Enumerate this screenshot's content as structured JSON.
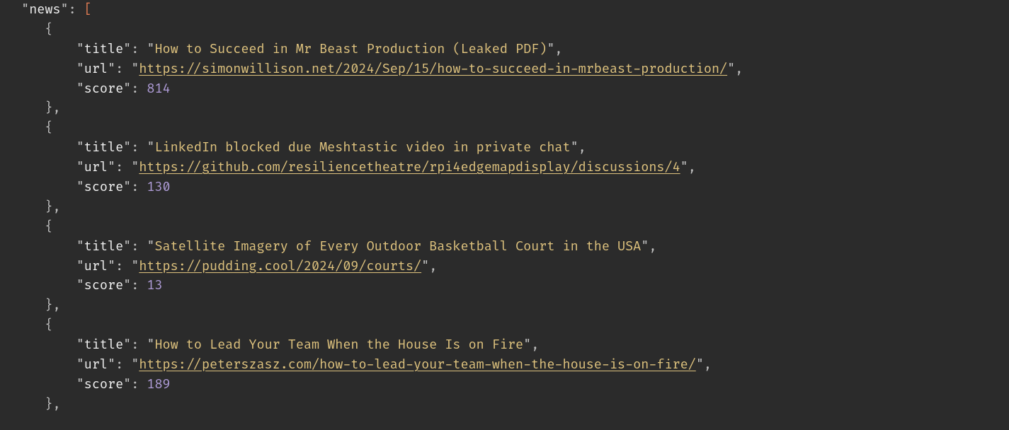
{
  "root_key": "news",
  "items": [
    {
      "title": "How to Succeed in Mr Beast Production (Leaked PDF)",
      "url": "https://simonwillison.net/2024/Sep/15/how-to-succeed-in-mrbeast-production/",
      "score": 814
    },
    {
      "title": "LinkedIn blocked due Meshtastic video in private chat",
      "url": "https://github.com/resiliencetheatre/rpi4edgemapdisplay/discussions/4",
      "score": 130
    },
    {
      "title": "Satellite Imagery of Every Outdoor Basketball Court in the USA",
      "url": "https://pudding.cool/2024/09/courts/",
      "score": 13
    },
    {
      "title": "How to Lead Your Team When the House Is on Fire",
      "url": "https://peterszasz.com/how-to-lead-your-team-when-the-house-is-on-fire/",
      "score": 189
    }
  ],
  "field_labels": {
    "title": "title",
    "url": "url",
    "score": "score"
  }
}
